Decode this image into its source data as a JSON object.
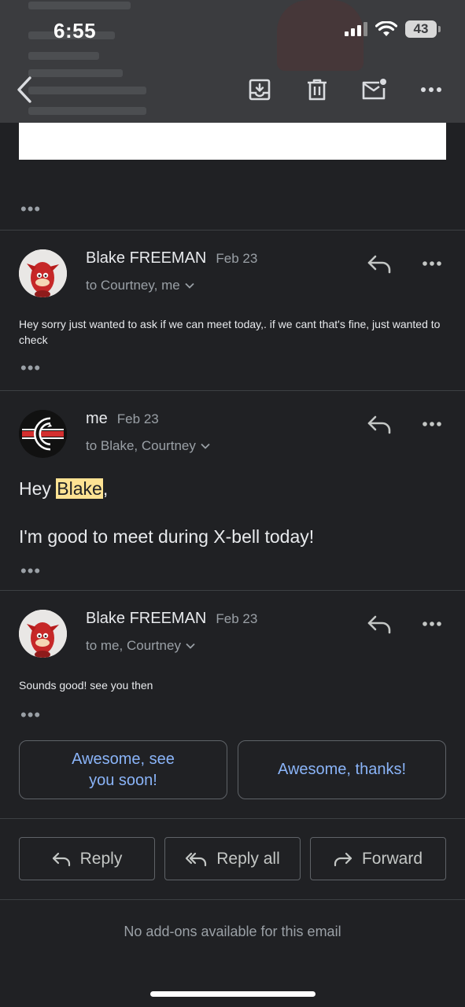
{
  "status_bar": {
    "time": "6:55",
    "battery": "43"
  },
  "toolbar": {
    "back_icon": "chevron-left-icon",
    "archive_icon": "archive-icon",
    "delete_icon": "trash-icon",
    "mark_unread_icon": "mail-unread-icon",
    "more_icon": "more-horiz-icon"
  },
  "messages": [
    {
      "sender": "Blake FREEMAN",
      "date": "Feb 23",
      "recipients": "to Courtney, me",
      "body": "Hey sorry just wanted to ask if we can meet today,. if we cant that's fine, just wanted to check"
    },
    {
      "sender": "me",
      "date": "Feb 23",
      "recipients": "to Blake, Courtney",
      "greeting_prefix": "Hey ",
      "greeting_name": "Blake",
      "greeting_suffix": ",",
      "body": "I'm good to meet during X-bell today!"
    },
    {
      "sender": "Blake FREEMAN",
      "date": "Feb 23",
      "recipients": "to me, Courtney",
      "body": "Sounds good! see you then"
    }
  ],
  "smart_replies": [
    "Awesome, see you soon!",
    "Awesome, thanks!"
  ],
  "actions": {
    "reply": "Reply",
    "reply_all": "Reply all",
    "forward": "Forward"
  },
  "addons_text": "No add-ons available for this email",
  "colors": {
    "background": "#202124",
    "accent": "#8ab4f8",
    "highlight": "#fde293"
  }
}
